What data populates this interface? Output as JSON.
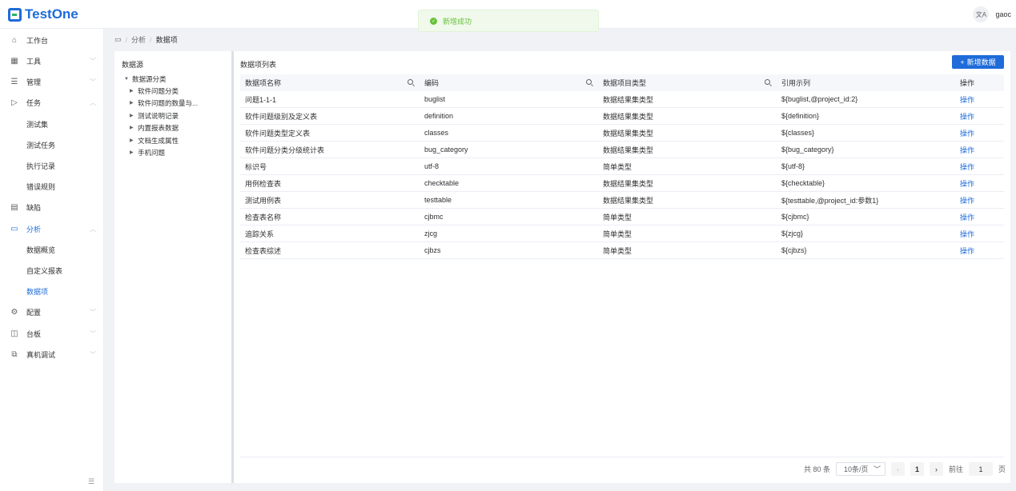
{
  "app": {
    "name": "TestOne",
    "user": "gaoc",
    "translate_icon": "translate-icon"
  },
  "toast": {
    "message": "新增成功"
  },
  "sidebar": {
    "items": [
      {
        "label": "工作台",
        "icon": "home-icon",
        "arrow": ""
      },
      {
        "label": "工具",
        "icon": "grid-icon",
        "arrow": "chevron-down"
      },
      {
        "label": "管理",
        "icon": "list-icon",
        "arrow": "chevron-down"
      },
      {
        "label": "任务",
        "icon": "send-icon",
        "arrow": "chevron-up"
      },
      {
        "label": "测试集"
      },
      {
        "label": "测试任务"
      },
      {
        "label": "执行记录"
      },
      {
        "label": "错误规则"
      },
      {
        "label": "缺陷",
        "icon": "doc-icon",
        "arrow": ""
      },
      {
        "label": "分析",
        "icon": "calendar-icon",
        "arrow": "chevron-up"
      },
      {
        "label": "数据概览"
      },
      {
        "label": "自定义报表"
      },
      {
        "label": "数据项"
      },
      {
        "label": "配置",
        "icon": "gear-icon",
        "arrow": "chevron-down"
      },
      {
        "label": "台板",
        "icon": "panel-icon",
        "arrow": "chevron-down"
      },
      {
        "label": "真机调试",
        "icon": "device-icon",
        "arrow": "chevron-down"
      }
    ]
  },
  "breadcrumb": {
    "level1": "分析",
    "level2": "数据项"
  },
  "tree": {
    "title": "数据源",
    "root": "数据源分类",
    "children": [
      "软件问题分类",
      "软件问题的数量与...",
      "测试说明记录",
      "内置报表数据",
      "文档生成属性",
      "手机问题"
    ]
  },
  "main": {
    "title": "数据项列表",
    "add_button": "新增数据",
    "columns": [
      "数据项名称",
      "编码",
      "数据项目类型",
      "引用示列",
      "操作"
    ],
    "rows": [
      [
        "问题1-1-1",
        "buglist",
        "数据结果集类型",
        "${buglist,@project_id:2}",
        "操作"
      ],
      [
        "软件问题级别及定义表",
        "definition",
        "数据结果集类型",
        "${definition}",
        "操作"
      ],
      [
        "软件问题类型定义表",
        "classes",
        "数据结果集类型",
        "${classes}",
        "操作"
      ],
      [
        "软件问题分类分级统计表",
        "bug_category",
        "数据结果集类型",
        "${bug_category}",
        "操作"
      ],
      [
        "标识号",
        "utf-8",
        "简单类型",
        "${utf-8}",
        "操作"
      ],
      [
        "用例检查表",
        "checktable",
        "数据结果集类型",
        "${checktable}",
        "操作"
      ],
      [
        "测试用例表",
        "testtable",
        "数据结果集类型",
        "${testtable,@project_id:参数1}",
        "操作"
      ],
      [
        "检查表名称",
        "cjbmc",
        "简单类型",
        "${cjbmc}",
        "操作"
      ],
      [
        "追踪关系",
        "zjcg",
        "简单类型",
        "${zjcg}",
        "操作"
      ],
      [
        "检查表综述",
        "cjbzs",
        "简单类型",
        "${cjbzs}",
        "操作"
      ]
    ]
  },
  "pagination": {
    "total": "共 80 条",
    "page_size": "10条/页",
    "current": "1",
    "goto_prefix": "前往",
    "goto_value": "1",
    "goto_suffix": "页"
  }
}
